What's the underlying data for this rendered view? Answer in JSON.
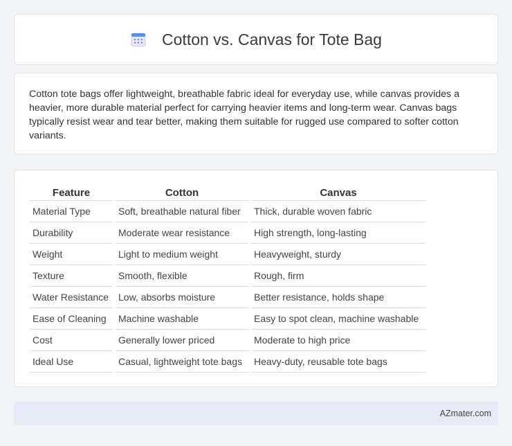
{
  "header": {
    "title": "Cotton vs. Canvas for Tote Bag",
    "icon": "calendar-icon"
  },
  "intro": {
    "text": "Cotton tote bags offer lightweight, breathable fabric ideal for everyday use, while canvas provides a heavier, more durable material perfect for carrying heavier items and long-term wear. Canvas bags typically resist wear and tear better, making them suitable for rugged use compared to softer cotton variants."
  },
  "table": {
    "headers": [
      "Feature",
      "Cotton",
      "Canvas"
    ],
    "rows": [
      [
        "Material Type",
        "Soft, breathable natural fiber",
        "Thick, durable woven fabric"
      ],
      [
        "Durability",
        "Moderate wear resistance",
        "High strength, long-lasting"
      ],
      [
        "Weight",
        "Light to medium weight",
        "Heavyweight, sturdy"
      ],
      [
        "Texture",
        "Smooth, flexible",
        "Rough, firm"
      ],
      [
        "Water Resistance",
        "Low, absorbs moisture",
        "Better resistance, holds shape"
      ],
      [
        "Ease of Cleaning",
        "Machine washable",
        "Easy to spot clean, machine washable"
      ],
      [
        "Cost",
        "Generally lower priced",
        "Moderate to high price"
      ],
      [
        "Ideal Use",
        "Casual, lightweight tote bags",
        "Heavy-duty, reusable tote bags"
      ]
    ]
  },
  "footer": {
    "text": "AZmater.com"
  }
}
